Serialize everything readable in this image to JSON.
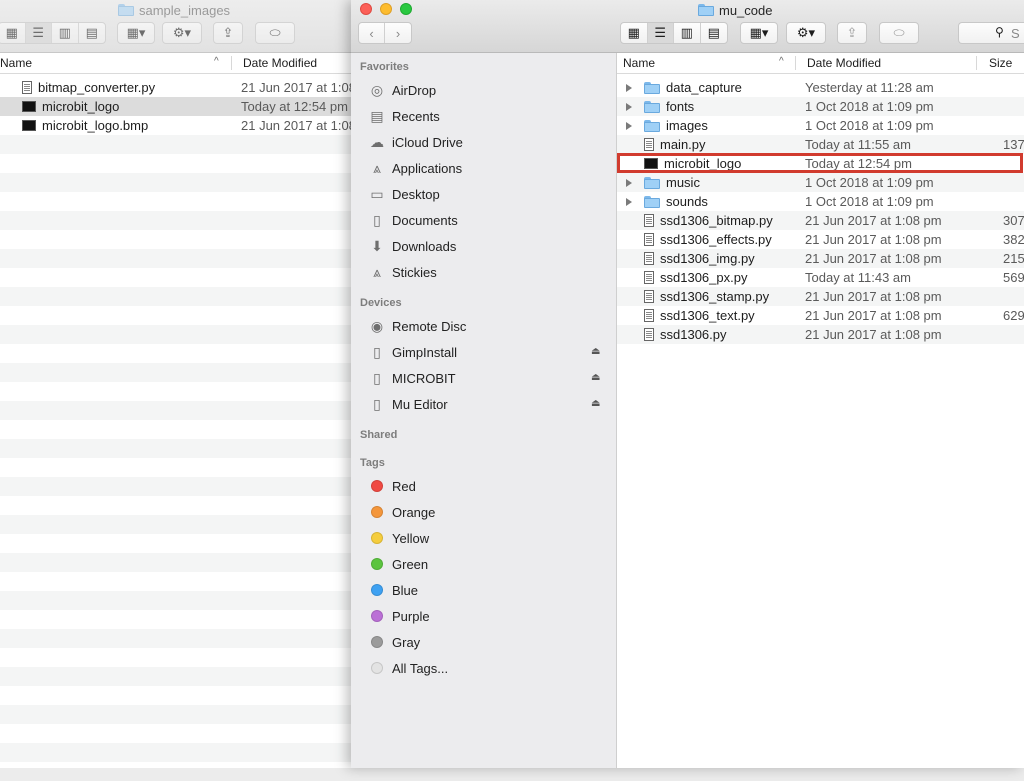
{
  "back_window": {
    "title": "sample_images",
    "col_name": "Name",
    "col_date": "Date Modified",
    "files": [
      {
        "name": "bitmap_converter.py",
        "date": "21 Jun 2017 at 1:08",
        "icon": "python-file-icon",
        "selected": false
      },
      {
        "name": "microbit_logo",
        "date": "Today at 12:54 pm",
        "icon": "image-file-icon",
        "selected": true
      },
      {
        "name": "microbit_logo.bmp",
        "date": "21 Jun 2017 at 1:08",
        "icon": "bitmap-file-icon",
        "selected": false
      }
    ]
  },
  "front_window": {
    "title": "mu_code",
    "search_placeholder": "S",
    "sidebar": {
      "favorites_heading": "Favorites",
      "favorites": [
        {
          "label": "AirDrop",
          "icon": "airdrop-icon"
        },
        {
          "label": "Recents",
          "icon": "recents-icon"
        },
        {
          "label": "iCloud Drive",
          "icon": "cloud-icon"
        },
        {
          "label": "Applications",
          "icon": "applications-icon"
        },
        {
          "label": "Desktop",
          "icon": "desktop-icon"
        },
        {
          "label": "Documents",
          "icon": "documents-icon"
        },
        {
          "label": "Downloads",
          "icon": "downloads-icon"
        },
        {
          "label": "Stickies",
          "icon": "applications-icon"
        }
      ],
      "devices_heading": "Devices",
      "devices": [
        {
          "label": "Remote Disc",
          "icon": "disc-icon",
          "eject": false
        },
        {
          "label": "GimpInstall",
          "icon": "drive-icon",
          "eject": true
        },
        {
          "label": "MICROBIT",
          "icon": "drive-icon",
          "eject": true
        },
        {
          "label": "Mu Editor",
          "icon": "drive-icon",
          "eject": true
        }
      ],
      "shared_heading": "Shared",
      "tags_heading": "Tags",
      "tags": [
        {
          "label": "Red",
          "color": "#f04a43"
        },
        {
          "label": "Orange",
          "color": "#f4963b"
        },
        {
          "label": "Yellow",
          "color": "#f5cd3d"
        },
        {
          "label": "Green",
          "color": "#5cc43f"
        },
        {
          "label": "Blue",
          "color": "#3ea1f2"
        },
        {
          "label": "Purple",
          "color": "#bb70d6"
        },
        {
          "label": "Gray",
          "color": "#9b9b9b"
        },
        {
          "label": "All Tags...",
          "color": "#e3e3e3"
        }
      ]
    },
    "list": {
      "col_name": "Name",
      "col_date": "Date Modified",
      "col_size": "Size",
      "items": [
        {
          "name": "data_capture",
          "date": "Yesterday at 11:28 am",
          "size": "",
          "type": "folder"
        },
        {
          "name": "fonts",
          "date": "1 Oct 2018 at 1:09 pm",
          "size": "",
          "type": "folder"
        },
        {
          "name": "images",
          "date": "1 Oct 2018 at 1:09 pm",
          "size": "",
          "type": "folder"
        },
        {
          "name": "main.py",
          "date": "Today at 11:55 am",
          "size": "137",
          "type": "file"
        },
        {
          "name": "microbit_logo",
          "date": "Today at 12:54 pm",
          "size": "",
          "type": "image"
        },
        {
          "name": "music",
          "date": "1 Oct 2018 at 1:09 pm",
          "size": "",
          "type": "folder"
        },
        {
          "name": "sounds",
          "date": "1 Oct 2018 at 1:09 pm",
          "size": "",
          "type": "folder"
        },
        {
          "name": "ssd1306_bitmap.py",
          "date": "21 Jun 2017 at 1:08 pm",
          "size": "307",
          "type": "file"
        },
        {
          "name": "ssd1306_effects.py",
          "date": "21 Jun 2017 at 1:08 pm",
          "size": "382",
          "type": "file"
        },
        {
          "name": "ssd1306_img.py",
          "date": "21 Jun 2017 at 1:08 pm",
          "size": "215",
          "type": "file"
        },
        {
          "name": "ssd1306_px.py",
          "date": "Today at 11:43 am",
          "size": "569",
          "type": "file"
        },
        {
          "name": "ssd1306_stamp.py",
          "date": "21 Jun 2017 at 1:08 pm",
          "size": "",
          "type": "file"
        },
        {
          "name": "ssd1306_text.py",
          "date": "21 Jun 2017 at 1:08 pm",
          "size": "629",
          "type": "file"
        },
        {
          "name": "ssd1306.py",
          "date": "21 Jun 2017 at 1:08 pm",
          "size": "",
          "type": "file"
        }
      ]
    }
  }
}
